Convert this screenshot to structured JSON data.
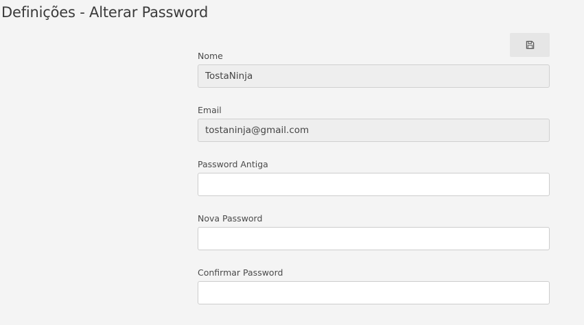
{
  "page": {
    "title": "Definições - Alterar Password"
  },
  "toolbar": {
    "save_icon": "floppy-disk-icon"
  },
  "form": {
    "fields": [
      {
        "label": "Nome",
        "value": "TostaNinja",
        "placeholder": "",
        "readonly": true
      },
      {
        "label": "Email",
        "value": "tostaninja@gmail.com",
        "placeholder": "",
        "readonly": true
      },
      {
        "label": "Password Antiga",
        "value": "",
        "placeholder": "",
        "readonly": false
      },
      {
        "label": "Nova Password",
        "value": "",
        "placeholder": "",
        "readonly": false
      },
      {
        "label": "Confirmar Password",
        "value": "",
        "placeholder": "",
        "readonly": false
      }
    ]
  },
  "colors": {
    "background": "#f4f4f4",
    "readonly_field": "#eeeeee",
    "input_border": "#cccccc",
    "button": "#e6e6e6"
  }
}
